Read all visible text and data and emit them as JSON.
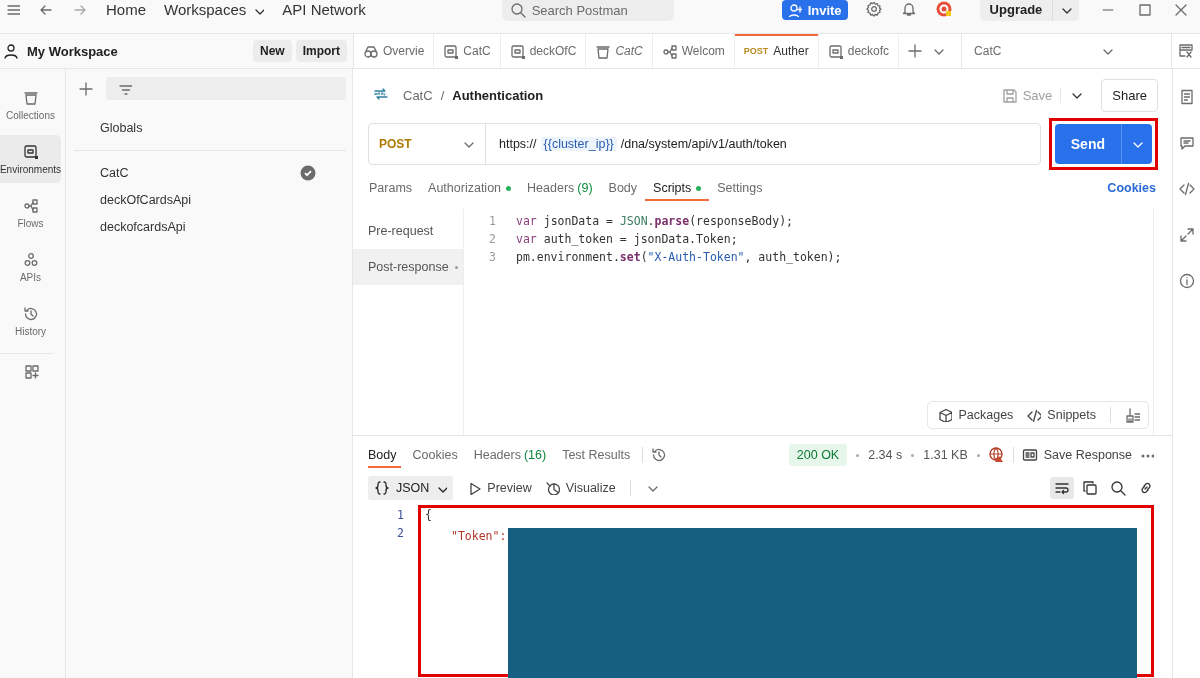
{
  "topbar": {
    "nav": [
      {
        "label": "Home",
        "dropdown": false
      },
      {
        "label": "Workspaces",
        "dropdown": true
      },
      {
        "label": "API Network",
        "dropdown": false
      }
    ],
    "search": {
      "placeholder": "Search Postman"
    },
    "invite": "Invite",
    "upgrade": "Upgrade"
  },
  "workspace": {
    "title": "My Workspace",
    "buttons": [
      "New",
      "Import"
    ]
  },
  "tabs": [
    {
      "label": "Overvie",
      "kind": "overview",
      "italic": false,
      "selected": false
    },
    {
      "label": "CatC",
      "kind": "environment",
      "italic": false,
      "selected": false
    },
    {
      "label": "deckOfC",
      "kind": "environment",
      "italic": false,
      "selected": false
    },
    {
      "label": "CatC",
      "kind": "collection",
      "italic": true,
      "selected": false
    },
    {
      "label": "Welcom",
      "kind": "flow",
      "italic": false,
      "selected": false
    },
    {
      "label": "Auther",
      "kind": "request",
      "method": "POST",
      "italic": false,
      "selected": true
    },
    {
      "label": "deckofc",
      "kind": "environment",
      "italic": false,
      "selected": false
    }
  ],
  "environment_selector": "CatC",
  "sidebar": {
    "items": [
      {
        "label": "Collections",
        "kind": "collections",
        "selected": false
      },
      {
        "label": "Environments",
        "kind": "environments",
        "selected": true
      },
      {
        "label": "Flows",
        "kind": "flows",
        "selected": false
      },
      {
        "label": "APIs",
        "kind": "apis",
        "selected": false
      },
      {
        "label": "History",
        "kind": "history",
        "selected": false
      }
    ]
  },
  "environments": {
    "globals": "Globals",
    "items": [
      {
        "label": "CatC",
        "active": true
      },
      {
        "label": "deckOfCardsApi",
        "active": false
      },
      {
        "label": "deckofcardsApi",
        "active": false
      }
    ]
  },
  "request": {
    "breadcrumb": {
      "parent": "CatC",
      "separator": "/",
      "name": "Authentication"
    },
    "save": "Save",
    "share": "Share",
    "method": "POST",
    "url": {
      "scheme": "https://",
      "variable": "{{cluster_ip}}",
      "path": "/dna/system/api/v1/auth/token"
    },
    "send": "Send",
    "send_highlighted": true,
    "tabs": [
      {
        "label": "Params",
        "dot": false,
        "selected": false
      },
      {
        "label": "Authorization",
        "dot": true,
        "selected": false
      },
      {
        "label": "Headers",
        "count": "(9)",
        "dot": false,
        "selected": false
      },
      {
        "label": "Body",
        "dot": false,
        "selected": false
      },
      {
        "label": "Scripts",
        "dot": true,
        "selected": true
      },
      {
        "label": "Settings",
        "dot": false,
        "selected": false
      }
    ],
    "cookies": "Cookies",
    "script_tabs": [
      {
        "label": "Pre-request",
        "dot": false,
        "selected": false
      },
      {
        "label": "Post-response",
        "dot": true,
        "selected": true
      }
    ],
    "code": [
      {
        "number": "1",
        "segments": [
          {
            "text": "var ",
            "kind": "keyword"
          },
          {
            "text": "jsonData = ",
            "kind": "plain"
          },
          {
            "text": "JSON",
            "kind": "builtin"
          },
          {
            "text": ".",
            "kind": "plain"
          },
          {
            "text": "parse",
            "kind": "method"
          },
          {
            "text": "(responseBody);",
            "kind": "plain"
          }
        ]
      },
      {
        "number": "2",
        "segments": [
          {
            "text": "var ",
            "kind": "keyword"
          },
          {
            "text": "auth_token = jsonData.Token;",
            "kind": "plain"
          }
        ]
      },
      {
        "number": "3",
        "segments": [
          {
            "text": "pm.environment.",
            "kind": "plain"
          },
          {
            "text": "set",
            "kind": "method"
          },
          {
            "text": "(",
            "kind": "plain"
          },
          {
            "text": "\"X-Auth-Token\"",
            "kind": "string"
          },
          {
            "text": ", auth_token);",
            "kind": "plain"
          }
        ]
      }
    ],
    "editor_tools": [
      "Packages",
      "Snippets"
    ]
  },
  "response": {
    "tabs": [
      {
        "label": "Body",
        "selected": true
      },
      {
        "label": "Cookies",
        "selected": false
      },
      {
        "label": "Headers",
        "count": "(16)",
        "selected": false
      },
      {
        "label": "Test Results",
        "selected": false
      }
    ],
    "status": "200 OK",
    "time": "2.34 s",
    "size": "1.31 KB",
    "save_response": "Save Response",
    "format": "JSON",
    "views": [
      "Preview",
      "Visualize"
    ],
    "body_highlighted": true,
    "lines": [
      {
        "number": "1",
        "text": "{"
      },
      {
        "number": "2",
        "text": "\"Token\":",
        "redacted": true
      }
    ]
  }
}
